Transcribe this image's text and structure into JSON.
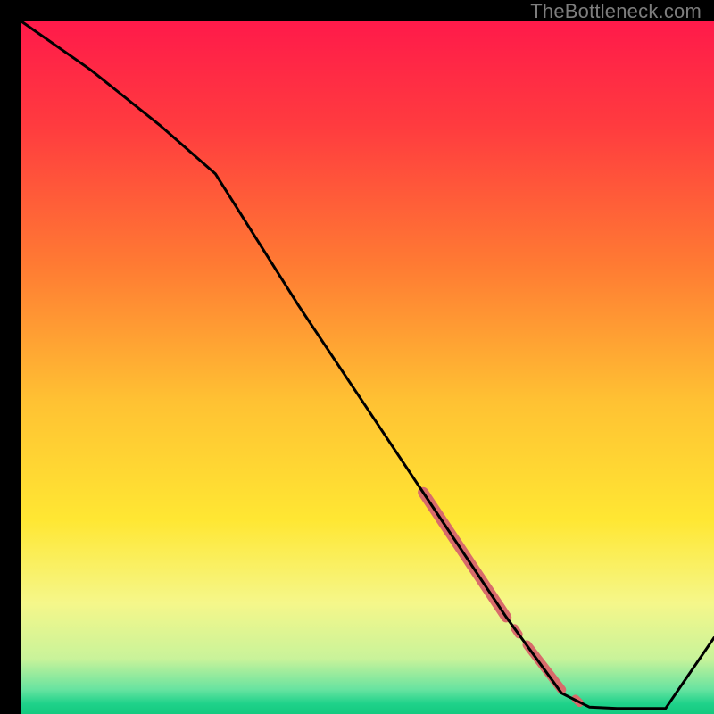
{
  "watermark": "TheBottleneck.com",
  "chart_data": {
    "type": "line",
    "title": "",
    "xlabel": "",
    "ylabel": "",
    "xlim": [
      0,
      100
    ],
    "ylim": [
      0,
      100
    ],
    "background_gradient": {
      "stops": [
        {
          "pos": 0.0,
          "color": "#ff1a4a"
        },
        {
          "pos": 0.15,
          "color": "#ff3b3f"
        },
        {
          "pos": 0.35,
          "color": "#ff7a33"
        },
        {
          "pos": 0.55,
          "color": "#ffc233"
        },
        {
          "pos": 0.72,
          "color": "#ffe733"
        },
        {
          "pos": 0.84,
          "color": "#f5f78a"
        },
        {
          "pos": 0.92,
          "color": "#c9f39a"
        },
        {
          "pos": 0.965,
          "color": "#66e3a0"
        },
        {
          "pos": 0.985,
          "color": "#1fd28a"
        },
        {
          "pos": 1.0,
          "color": "#14c97f"
        }
      ]
    },
    "series": [
      {
        "name": "bottleneck-curve",
        "color": "#000000",
        "x": [
          0,
          10,
          20,
          28,
          40,
          50,
          60,
          70,
          78,
          82,
          86,
          93,
          100
        ],
        "y": [
          100,
          93,
          85,
          78,
          59,
          44,
          29,
          14,
          3,
          1,
          0.8,
          0.8,
          11
        ]
      }
    ],
    "highlight_segments": [
      {
        "name": "band-main",
        "color": "#d86b6b",
        "width": 12,
        "x": [
          58,
          70
        ],
        "y": [
          32,
          14
        ]
      },
      {
        "name": "band-mid",
        "color": "#d86b6b",
        "width": 10,
        "x": [
          73,
          78
        ],
        "y": [
          10,
          3.5
        ]
      },
      {
        "name": "dot-1",
        "color": "#d86b6b",
        "width": 9,
        "x": [
          71.2,
          71.8
        ],
        "y": [
          12.4,
          11.5
        ]
      },
      {
        "name": "dot-2",
        "color": "#d86b6b",
        "width": 9,
        "x": [
          80,
          80.6
        ],
        "y": [
          2.2,
          1.6
        ]
      }
    ]
  }
}
